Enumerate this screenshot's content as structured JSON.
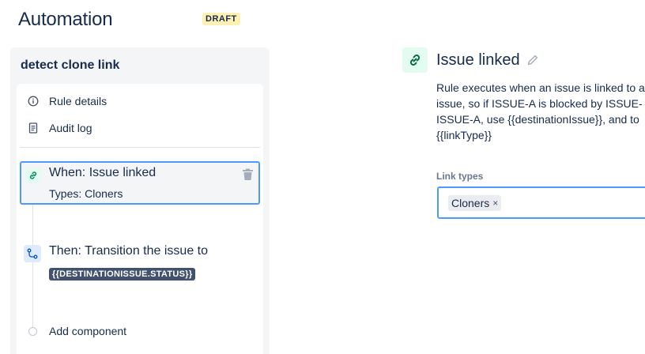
{
  "header": {
    "title": "Automation",
    "status_badge": "DRAFT"
  },
  "rule": {
    "name": "detect clone link",
    "nav": [
      {
        "label": "Rule details",
        "icon": "info-icon"
      },
      {
        "label": "Audit log",
        "icon": "document-icon"
      }
    ],
    "trigger": {
      "title": "When: Issue linked",
      "subtitle": "Types: Cloners",
      "icon": "link-icon"
    },
    "action": {
      "title": "Then: Transition the issue to",
      "tag": "{{DESTINATIONISSUE.STATUS}}",
      "icon": "transition-icon"
    },
    "add_component_label": "Add component"
  },
  "detail": {
    "title": "Issue linked",
    "description_lines": [
      "Rule executes when an issue is linked to a",
      "issue, so if ISSUE-A is blocked by ISSUE-",
      "ISSUE-A, use {{destinationIssue}}, and to",
      "{{linkType}}"
    ],
    "link_types_label": "Link types",
    "selected_link_types": [
      {
        "label": "Cloners",
        "remove": "×"
      }
    ]
  },
  "colors": {
    "accent": "#4c9aff",
    "trigger_bg": "#e3fcef",
    "action_bg": "#deebff",
    "badge_bg": "#fff0b3"
  }
}
